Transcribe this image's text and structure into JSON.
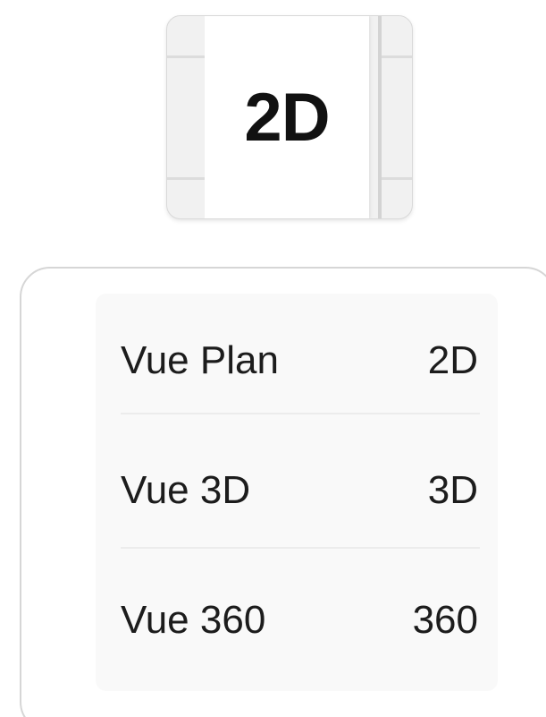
{
  "toggle": {
    "label": "2D"
  },
  "menu": {
    "items": [
      {
        "label": "Vue Plan",
        "shortcut": "2D"
      },
      {
        "label": "Vue 3D",
        "shortcut": "3D"
      },
      {
        "label": "Vue 360",
        "shortcut": "360"
      }
    ]
  },
  "colors": {
    "text": "#111111",
    "border": "#d6d6d6",
    "menu_background": "#f9f9f9",
    "separator": "#ececec"
  }
}
